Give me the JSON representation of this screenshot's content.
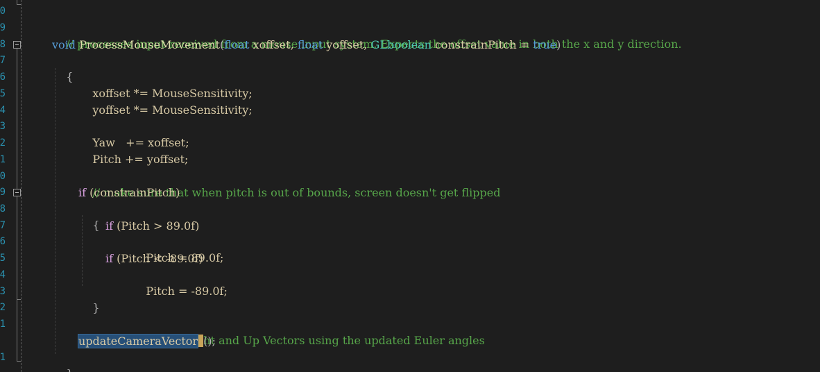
{
  "editor": {
    "line_numbers": [
      "0",
      "9",
      "8",
      "7",
      "6",
      "5",
      "4",
      "3",
      "2",
      "1",
      "0",
      "9",
      "8",
      "7",
      "6",
      "5",
      "4",
      "3",
      "2",
      "1",
      "",
      "1"
    ],
    "code": {
      "comment_mouse": "// processes input received from a mouse input system. Expects the offset value in both the x and y direction.",
      "kw_void": "void",
      "fn_name": "ProcessMouseMovement",
      "paren_open": "(",
      "kw_float1": "float",
      "p_xoffset": " xoffset, ",
      "kw_float2": "float",
      "p_yoffset": " yoffset, ",
      "type_glboolean": "GLboolean",
      "p_constrain": " constrainPitch = ",
      "kw_true": "true",
      "paren_close": ")",
      "brace_open": "{",
      "x_mul": "xoffset *= MouseSensitivity;",
      "y_mul": "yoffset *= MouseSensitivity;",
      "yaw_add": "Yaw   += xoffset;",
      "pitch_add": "Pitch += yoffset;",
      "comment_pitch": "// make sure that when pitch is out of bounds, screen doesn't get flipped",
      "kw_if1": "if",
      "if1_cond": " (constrainPitch)",
      "inner_brace_open": "{",
      "kw_if2": "if",
      "if2_cond": " (Pitch > 89.0f)",
      "pitch_set_max": "Pitch = 89.0f;",
      "kw_if3": "if",
      "if3_cond": " (Pitch < -89.0f)",
      "pitch_set_min": "Pitch = -89.0f;",
      "inner_brace_close": "}",
      "comment_update": "// update Front, Right and Up Vectors using the updated Euler angles",
      "call_name": "updateCameraVector",
      "call_rest": "();",
      "brace_close": "}"
    }
  },
  "colors": {
    "background": "#1e1e1e",
    "comment": "#57a64a",
    "keyword": "#569cd6",
    "type": "#4ec9b0",
    "function": "#dcdcaa",
    "selection": "#264f78",
    "caret": "#c8a45a"
  },
  "icons": {
    "fold_toggle": "collapse-box-icon"
  }
}
